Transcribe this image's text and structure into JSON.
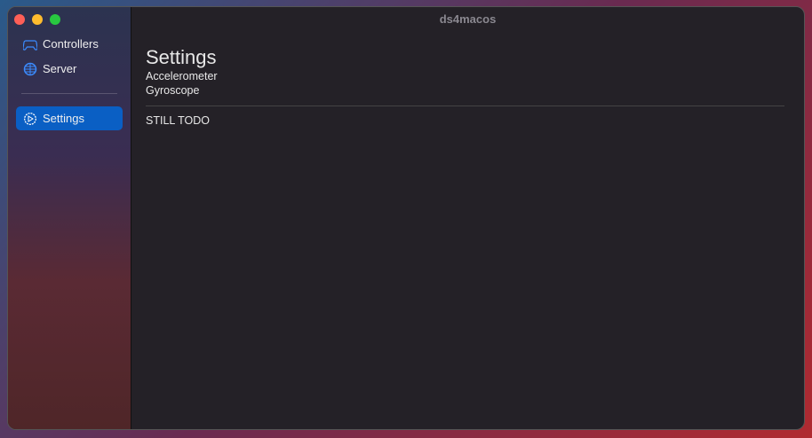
{
  "window": {
    "title": "ds4macos"
  },
  "sidebar": {
    "items": [
      {
        "label": "Controllers",
        "icon": "gamecontroller-icon"
      },
      {
        "label": "Server",
        "icon": "globe-icon"
      },
      {
        "label": "Settings",
        "icon": "gear-icon",
        "selected": true
      }
    ]
  },
  "main": {
    "heading": "Settings",
    "lines": [
      "Accelerometer",
      "Gyroscope"
    ],
    "body": "STILL TODO"
  },
  "colors": {
    "accent": "#0a5fc4"
  }
}
